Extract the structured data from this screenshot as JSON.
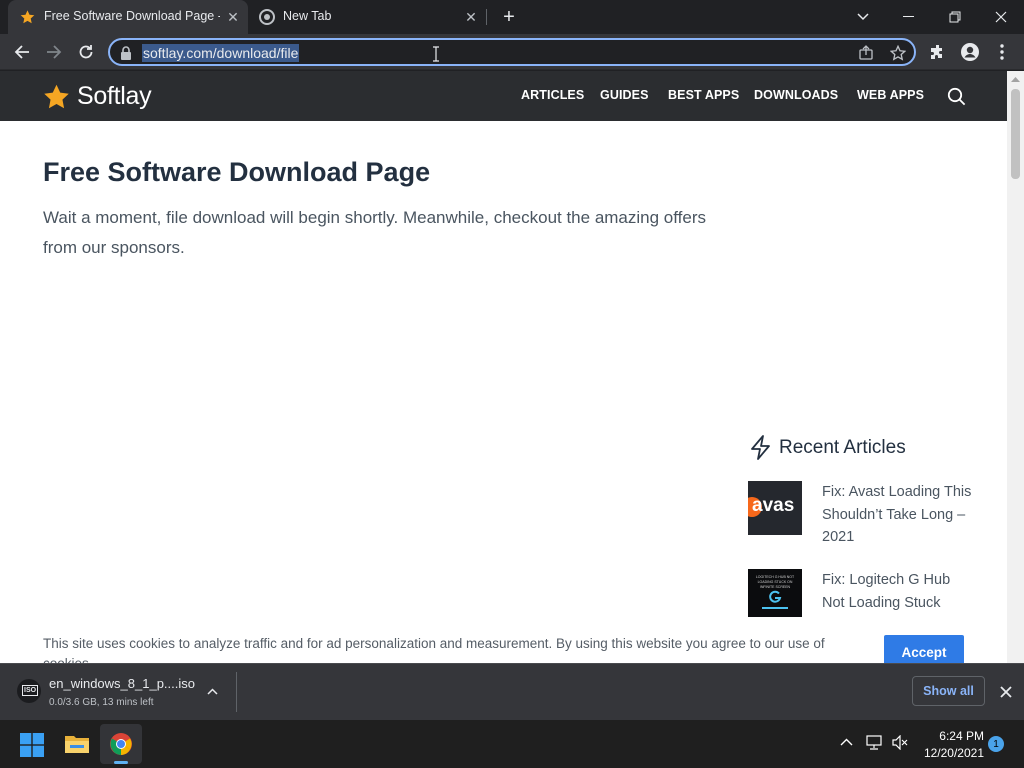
{
  "browser": {
    "tabs": [
      {
        "title": "Free Software Download Page - S",
        "active": true
      },
      {
        "title": "New Tab",
        "active": false
      }
    ],
    "address": {
      "url": "softlay.com/download/file"
    }
  },
  "site": {
    "logo_text": "Softlay",
    "nav": [
      "ARTICLES",
      "GUIDES",
      "BEST APPS",
      "DOWNLOADS",
      "WEB APPS"
    ],
    "accent_color": "#f5a623"
  },
  "content": {
    "title": "Free Software Download Page",
    "intro": "Wait a moment, file download will begin shortly. Meanwhile, checkout the amazing offers from our sponsors."
  },
  "sidebar": {
    "title": "Recent Articles",
    "articles": [
      {
        "title": "Fix: Avast Loading This Shouldn’t Take Long –2021",
        "thumb_text": "avas"
      },
      {
        "title": "Fix: Logitech G Hub Not Loading Stuck",
        "thumb_text": "LOGITECH G HUB NOT LOADING STUCK ON INFINITE SCREEN"
      }
    ]
  },
  "cookie": {
    "text": "This site uses cookies to analyze traffic and for ad personalization and measurement. By using this website you agree to our use of cookies.",
    "accept_label": "Accept"
  },
  "download": {
    "file_icon_label": "ISO",
    "file_name": "en_windows_8_1_p....iso",
    "status": "0.0/3.6 GB, 13 mins left",
    "show_all_label": "Show all"
  },
  "taskbar": {
    "time": "6:24 PM",
    "date": "12/20/2021",
    "notification_count": "1"
  }
}
